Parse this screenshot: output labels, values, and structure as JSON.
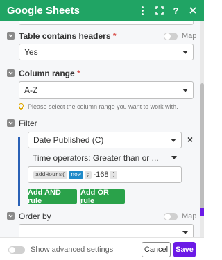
{
  "header": {
    "title": "Google Sheets",
    "icons": [
      "more-vertical-icon",
      "expand-icon",
      "help-icon",
      "close-icon"
    ]
  },
  "fields": {
    "table_headers": {
      "label": "Table contains headers",
      "required": "*",
      "map_label": "Map",
      "value": "Yes"
    },
    "column_range": {
      "label": "Column range",
      "required": "*",
      "value": "A-Z",
      "hint": "Please select the column range you want to work with."
    },
    "filter": {
      "label": "Filter",
      "column": "Date Published (C)",
      "operator": "Time operators: Greater than or ...",
      "formula": {
        "fn": "addHours(",
        "now": "now",
        "sep": ";",
        "value": "-168",
        "close": ")"
      },
      "add_and": "Add AND rule",
      "add_or": "Add OR rule"
    },
    "order_by": {
      "label": "Order by",
      "map_label": "Map",
      "value": ""
    }
  },
  "footer": {
    "advanced_label": "Show advanced settings",
    "cancel_label": "Cancel",
    "save_label": "Save"
  },
  "colors": {
    "header": "#20a464",
    "save": "#6b1ae6",
    "green_button": "#2aa24a",
    "filter_bar": "#2a61b6"
  }
}
